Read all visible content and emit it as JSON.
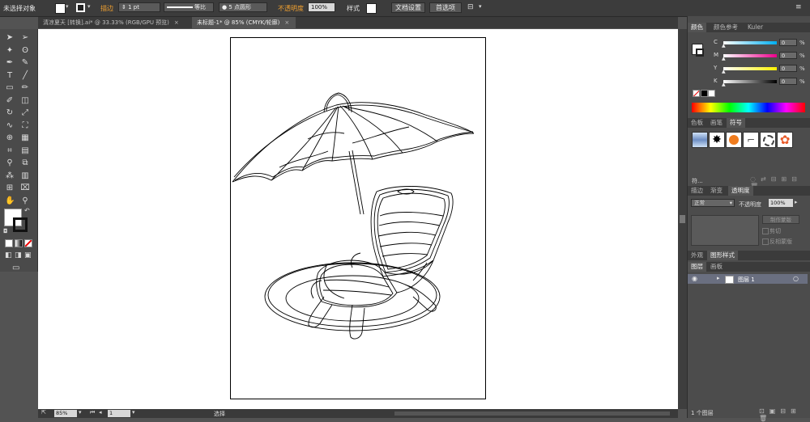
{
  "control_bar": {
    "selection_status": "未选择对象",
    "stroke_label": "描边",
    "stroke_weight": "1 pt",
    "profile_label": "等比",
    "brush_label": "5 点圆形",
    "opacity_label": "不透明度",
    "opacity_value": "100%",
    "style_label": "样式",
    "doc_setup_button": "文档设置",
    "prefs_button": "首选项"
  },
  "tabs": [
    {
      "label": "清凉夏天 [转换].ai* @ 33.33% (RGB/GPU 预览)",
      "active": false
    },
    {
      "label": "未标题-1* @ 85% (CMYK/轮廓)",
      "active": true
    }
  ],
  "tool_icons": [
    "selection-tool-icon",
    "direct-selection-tool-icon",
    "magic-wand-icon",
    "lasso-icon",
    "pen-icon",
    "curvature-icon",
    "type-icon",
    "line-icon",
    "rectangle-icon",
    "paintbrush-icon",
    "pencil-icon",
    "eraser-icon",
    "rotate-icon",
    "scale-icon",
    "warp-icon",
    "free-transform-icon",
    "shape-builder-icon",
    "perspective-icon",
    "mesh-icon",
    "gradient-icon",
    "eyedropper-icon",
    "blend-icon",
    "symbol-sprayer-icon",
    "graph-icon",
    "artboard-icon",
    "slice-icon",
    "hand-icon",
    "zoom-icon"
  ],
  "color_panel": {
    "tabs": [
      "颜色",
      "颜色参考",
      "Kuler"
    ],
    "channels": [
      {
        "label": "C",
        "value": "0",
        "unit": "%",
        "color": "#00aeef"
      },
      {
        "label": "M",
        "value": "0",
        "unit": "%",
        "color": "#ec008c"
      },
      {
        "label": "Y",
        "value": "0",
        "unit": "%",
        "color": "#fff200"
      },
      {
        "label": "K",
        "value": "0",
        "unit": "%",
        "color": "#000000"
      }
    ]
  },
  "swatch_panel": {
    "tabs": [
      "色板",
      "画笔",
      "符号"
    ],
    "symbol_label": "符..."
  },
  "transparency_panel": {
    "tabs": [
      "描边",
      "渐变",
      "透明度"
    ],
    "blend_mode": "正常",
    "opacity_label": "不透明度",
    "opacity_value": "100%",
    "make_mask_button": "制作蒙版",
    "clip_label": "剪切",
    "invert_label": "反相蒙版"
  },
  "appearance_tabs": [
    "外观",
    "图形样式"
  ],
  "layers_panel": {
    "tabs": [
      "图层",
      "画板"
    ],
    "layers": [
      {
        "name": "图层 1"
      }
    ],
    "count_label": "1 个图层"
  },
  "status_bar": {
    "zoom": "85%",
    "page": "1",
    "tool_status": "选择"
  }
}
